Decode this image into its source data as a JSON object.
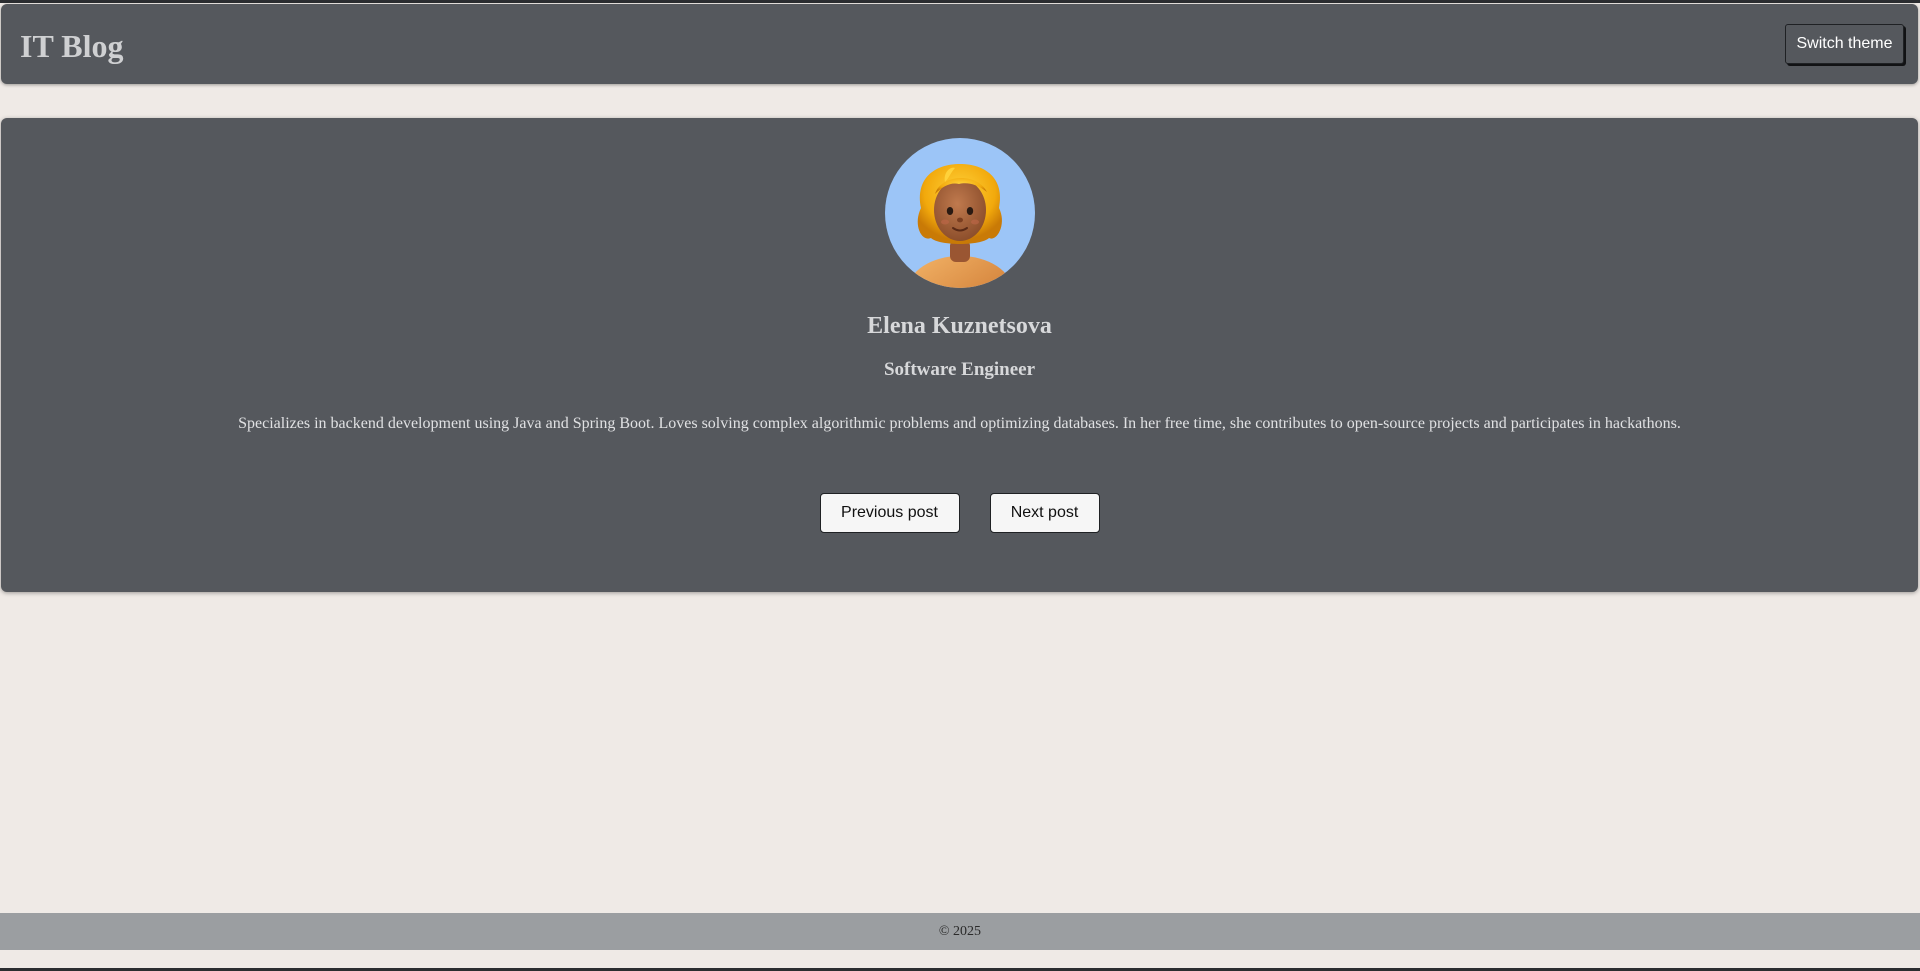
{
  "header": {
    "site_title": "IT Blog",
    "theme_button_label": "Switch theme"
  },
  "profile": {
    "avatar_icon": "avatar-illustration",
    "name": "Elena Kuznetsova",
    "role": "Software Engineer",
    "bio": "Specializes in backend development using Java and Spring Boot. Loves solving complex algorithmic problems and optimizing databases. In her free time, she contributes to open-source projects and participates in hackathons."
  },
  "navigation": {
    "previous_label": "Previous post",
    "next_label": "Next post"
  },
  "footer": {
    "copyright": "© 2025"
  },
  "colors": {
    "page_background": "#efeae6",
    "panel_background": "#55585d",
    "footer_background": "#9b9ea1",
    "avatar_background": "#9cc5f7"
  }
}
